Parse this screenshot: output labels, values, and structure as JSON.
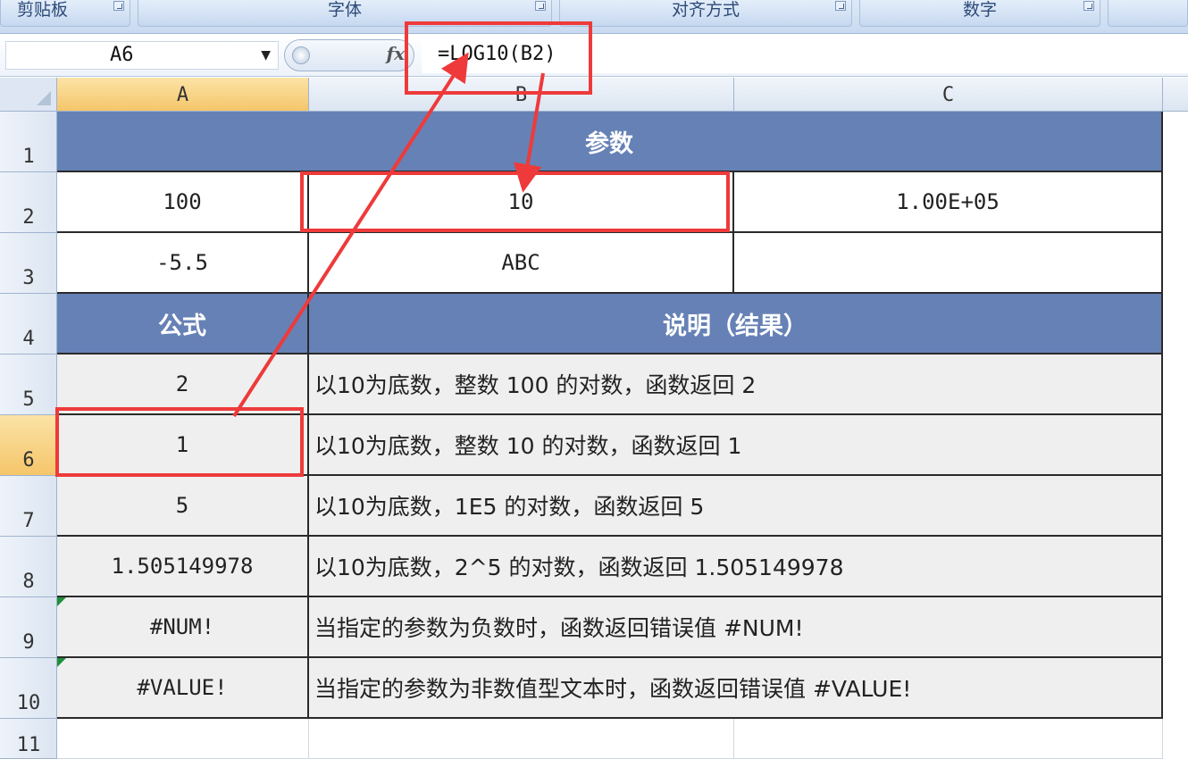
{
  "ribbon": {
    "groups": [
      "剪贴板",
      "字体",
      "对齐方式",
      "数字"
    ]
  },
  "formula_bar": {
    "name_box": "A6",
    "fx": "fx",
    "formula": "=LOG10(B2)"
  },
  "columns": [
    "A",
    "B",
    "C"
  ],
  "rows": [
    "1",
    "2",
    "3",
    "4",
    "5",
    "6",
    "7",
    "8",
    "9",
    "10",
    "11"
  ],
  "table": {
    "params_header": "参数",
    "params": [
      [
        "100",
        "10",
        "1.00E+05"
      ],
      [
        "-5.5",
        "ABC",
        ""
      ]
    ],
    "formula_header": "公式",
    "desc_header": "说明（结果）",
    "results": [
      {
        "value": "2",
        "desc": "以10为底数，整数 100 的对数，函数返回 2"
      },
      {
        "value": "1",
        "desc": "以10为底数，整数 10 的对数，函数返回 1"
      },
      {
        "value": "5",
        "desc": "以10为底数，1E5 的对数，函数返回 5"
      },
      {
        "value": "1.505149978",
        "desc": "以10为底数，2^5 的对数，函数返回 1.505149978"
      },
      {
        "value": "#NUM!",
        "desc": "当指定的参数为负数时，函数返回错误值 #NUM!"
      },
      {
        "value": "#VALUE!",
        "desc": "当指定的参数为非数值型文本时，函数返回错误值 #VALUE!"
      }
    ]
  },
  "colors": {
    "header_fill": "#6681b5",
    "annotation": "#ee3a3a",
    "selected_header": "#f5c66a"
  }
}
